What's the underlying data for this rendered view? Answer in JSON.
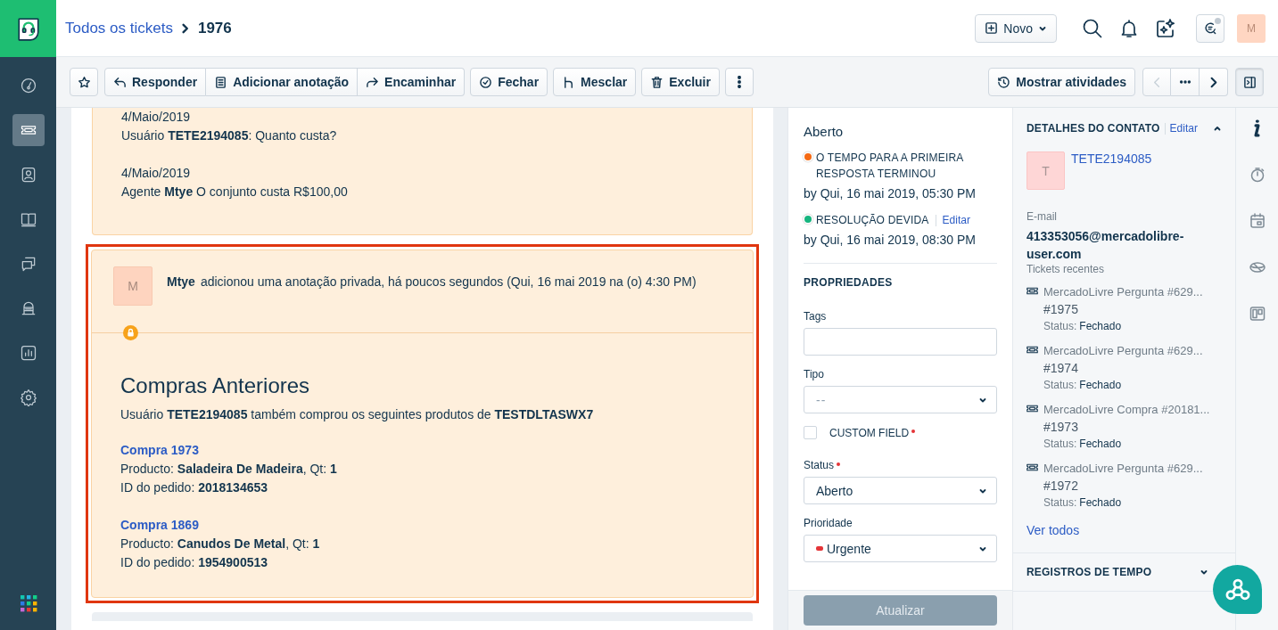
{
  "breadcrumb": {
    "link": "Todos os tickets",
    "current": "1976"
  },
  "header": {
    "new_button": "Novo",
    "avatar": "M",
    "chat_unread": true
  },
  "nav": [
    {
      "kind": "dashboard",
      "selected": false
    },
    {
      "kind": "tickets",
      "selected": true
    },
    {
      "kind": "contacts",
      "selected": false
    },
    {
      "kind": "knowledge",
      "selected": false
    },
    {
      "kind": "discussions",
      "selected": false
    },
    {
      "kind": "bots",
      "selected": false
    },
    {
      "kind": "reports",
      "selected": false
    },
    {
      "kind": "settings",
      "selected": false
    }
  ],
  "toolbar": {
    "actions": [
      {
        "kind": "star"
      },
      {
        "kind": "reply",
        "label": "Responder"
      },
      {
        "kind": "note",
        "label": "Adicionar anotação"
      },
      {
        "kind": "forward",
        "label": "Encaminhar"
      },
      {
        "kind": "close",
        "label": "Fechar"
      },
      {
        "kind": "merge",
        "label": "Mesclar"
      },
      {
        "kind": "delete",
        "label": "Excluir"
      },
      {
        "kind": "more"
      }
    ],
    "activity_button": "Mostrar atividades",
    "prev_disabled": true
  },
  "previous_message": {
    "paragraphs": [
      {
        "date": "4/Maio/2019",
        "text": "Usuário **TETE2194085**: Quanto custa?"
      },
      {
        "date": "4/Maio/2019",
        "text": "Agente **Mtye** O conjunto custa R$100,00"
      }
    ]
  },
  "note": {
    "highlighted": true,
    "private": true,
    "avatar": "M",
    "author": "Mtye",
    "action": "adicionou uma anotação privada, há poucos segundos (Qui, 16 mai 2019 na (o) 4:30 PM)",
    "title": "Compras Anteriores",
    "intro": "Usuário **TETE2194085** também comprou os seguintes produtos de **TESTDLTASWX7**",
    "purchases": [
      {
        "link": "Compra 1973",
        "product": "Producto: **Saladeira De Madeira**, Qt: **1**",
        "order": "ID do pedido: **2018134653**"
      },
      {
        "link": "Compra 1869",
        "product": "Producto: **Canudos De Metal**, Qt: **1**",
        "order": "ID do pedido: **1954900513**"
      }
    ]
  },
  "sla": {
    "status": "Aberto",
    "items": [
      {
        "label": "O TEMPO PARA A PRIMEIRA RESPOSTA TERMINOU",
        "color": "#f56a14",
        "due": "by Qui, 16 mai 2019, 05:30 PM"
      },
      {
        "label": "RESOLUÇÃO DEVIDA",
        "edit": "Editar",
        "color": "#16b57f",
        "due": "by Qui, 16 mai 2019, 08:30 PM"
      }
    ]
  },
  "properties": {
    "title": "PROPRIEDADES",
    "fields": [
      {
        "kind": "text",
        "label": "Tags",
        "required": false
      },
      {
        "kind": "select",
        "label": "Tipo",
        "placeholder": "--",
        "required": false
      },
      {
        "kind": "checkbox",
        "label": "CUSTOM FIELD",
        "required": true,
        "checked": false
      },
      {
        "kind": "select",
        "label": "Status",
        "value": "Aberto",
        "required": true
      },
      {
        "kind": "select",
        "label": "Prioridade",
        "value": "Urgente",
        "color": "#e43538",
        "required": false
      }
    ]
  },
  "update_button": {
    "label": "Atualizar",
    "disabled": true
  },
  "contact": {
    "title": "DETALHES DO CONTATO",
    "edit": "Editar",
    "expanded": true,
    "avatar": "T",
    "name": "TETE2194085",
    "email_label": "E-mail",
    "email": "413353056@mercadolibre-user.com",
    "recent_label": "Tickets recentes",
    "tickets": [
      {
        "title": "MercadoLivre Pergunta #629...",
        "number": "#1975",
        "status_label": "Status:",
        "status": "Fechado"
      },
      {
        "title": "MercadoLivre Pergunta #629...",
        "number": "#1974",
        "status_label": "Status:",
        "status": "Fechado"
      },
      {
        "title": "MercadoLivre Compra #20181...",
        "number": "#1973",
        "status_label": "Status:",
        "status": "Fechado"
      },
      {
        "title": "MercadoLivre Pergunta #629...",
        "number": "#1972",
        "status_label": "Status:",
        "status": "Fechado"
      }
    ],
    "view_all": "Ver todos"
  },
  "time_log": {
    "title": "REGISTROS DE TEMPO",
    "expanded": false
  },
  "side_tabs": [
    {
      "kind": "info",
      "selected": true
    },
    {
      "kind": "timer",
      "selected": false
    },
    {
      "kind": "calendar",
      "selected": false
    },
    {
      "kind": "planet",
      "selected": false
    },
    {
      "kind": "board",
      "selected": false
    }
  ]
}
